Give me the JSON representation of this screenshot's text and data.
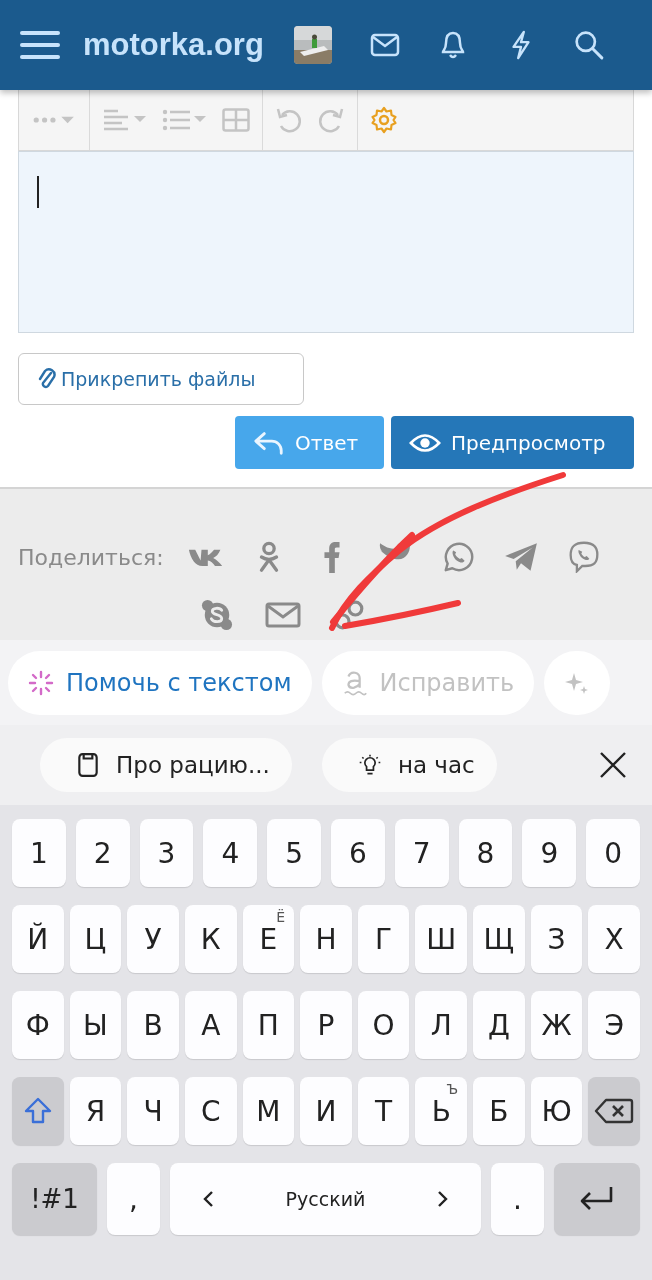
{
  "header": {
    "logo": "motorka.org"
  },
  "editor": {
    "focused": true
  },
  "attach_button": {
    "label": "Прикрепить файлы"
  },
  "action_buttons": [
    {
      "label": "Ответ",
      "kind": "reply"
    },
    {
      "label": "Предпросмотр",
      "kind": "preview"
    }
  ],
  "share": {
    "label": "Поделиться:"
  },
  "suggestion_chips": [
    {
      "label": "Помочь с текстом",
      "kind": "assist",
      "selected": true
    },
    {
      "label": "Исправить",
      "kind": "fix",
      "selected": false
    },
    {
      "kind": "sparkle",
      "selected": false
    }
  ],
  "clipboard_chips": [
    {
      "label": "Про рацию...",
      "kind": "clip"
    },
    {
      "label": "на час",
      "kind": "idea"
    }
  ],
  "keyboard": {
    "number_row": [
      {
        "label": "1"
      },
      {
        "label": "2"
      },
      {
        "label": "3"
      },
      {
        "label": "4"
      },
      {
        "label": "5"
      },
      {
        "label": "6"
      },
      {
        "label": "7"
      },
      {
        "label": "8"
      },
      {
        "label": "9"
      },
      {
        "label": "0"
      }
    ],
    "rows": [
      [
        {
          "label": "Й"
        },
        {
          "label": "Ц"
        },
        {
          "label": "У"
        },
        {
          "label": "К"
        },
        {
          "label": "Е",
          "hint": "Ё"
        },
        {
          "label": "Н"
        },
        {
          "label": "Г"
        },
        {
          "label": "Ш"
        },
        {
          "label": "Щ"
        },
        {
          "label": "З"
        },
        {
          "label": "Х"
        }
      ],
      [
        {
          "label": "Ф"
        },
        {
          "label": "Ы"
        },
        {
          "label": "В"
        },
        {
          "label": "А"
        },
        {
          "label": "П"
        },
        {
          "label": "Р"
        },
        {
          "label": "О"
        },
        {
          "label": "Л"
        },
        {
          "label": "Д"
        },
        {
          "label": "Ж"
        },
        {
          "label": "Э"
        }
      ],
      [
        {
          "kind": "shift",
          "on": true
        },
        {
          "label": "Я"
        },
        {
          "label": "Ч"
        },
        {
          "label": "С"
        },
        {
          "label": "М"
        },
        {
          "label": "И"
        },
        {
          "label": "Т"
        },
        {
          "label": "Ь",
          "hint": "Ъ"
        },
        {
          "label": "Б"
        },
        {
          "label": "Ю"
        },
        {
          "kind": "backspace"
        }
      ]
    ],
    "bottom_row": [
      {
        "kind": "symbols",
        "label": "!#1"
      },
      {
        "kind": "char",
        "label": ","
      },
      {
        "kind": "space",
        "label": "Русский"
      },
      {
        "kind": "char",
        "label": "."
      },
      {
        "kind": "enter"
      }
    ]
  }
}
